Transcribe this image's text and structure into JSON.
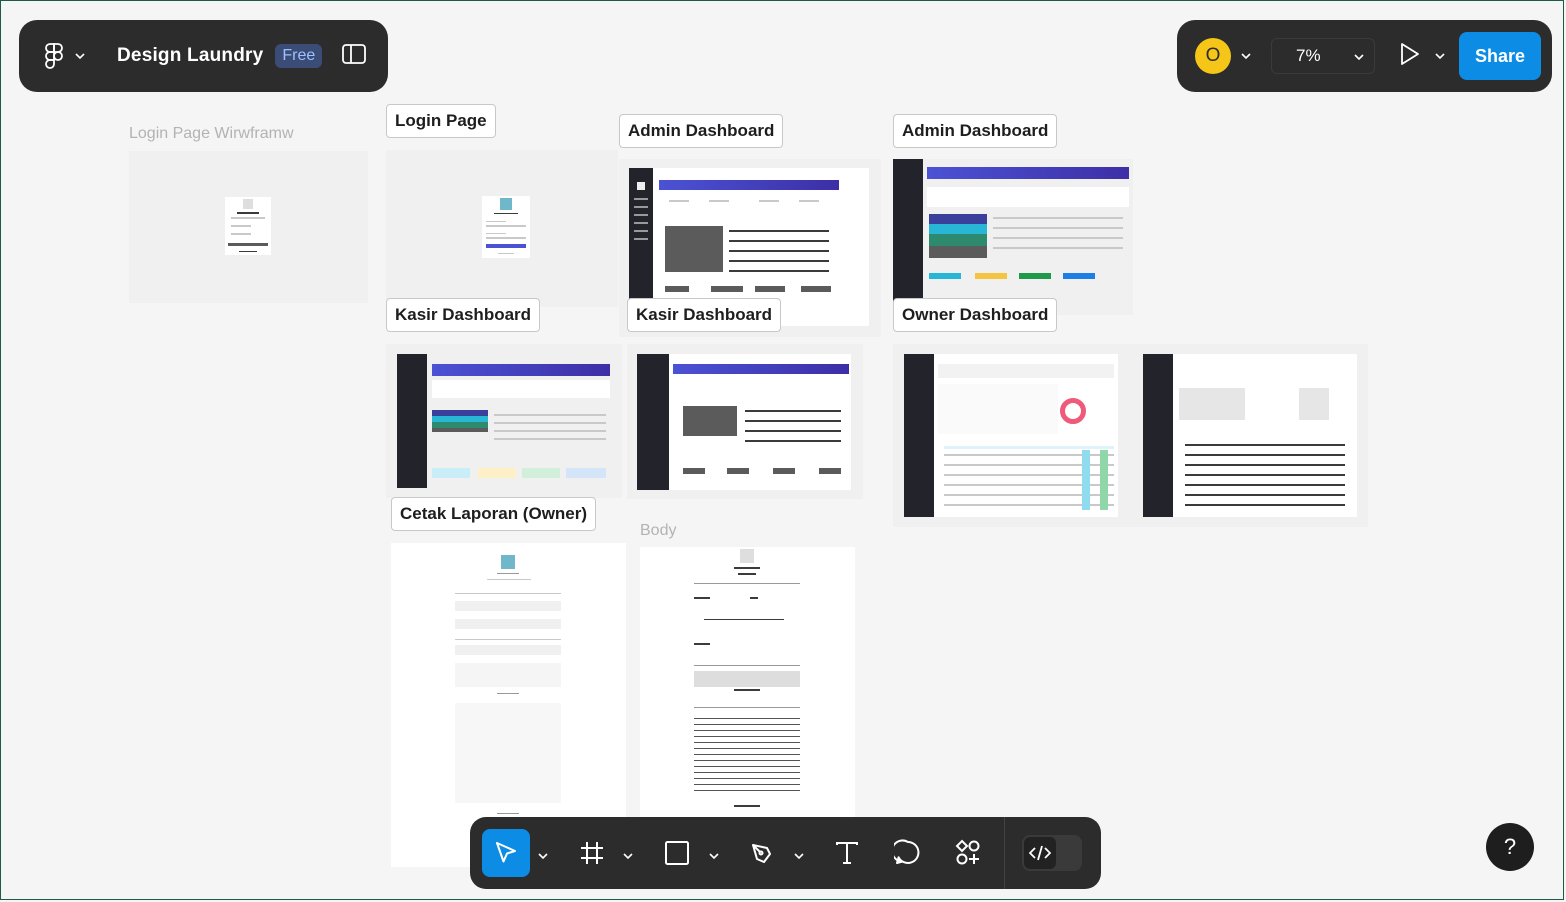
{
  "file": {
    "title": "Design Laundry",
    "plan_badge": "Free"
  },
  "user": {
    "initial": "O",
    "color": "#f5c518"
  },
  "zoom": {
    "value": "7%"
  },
  "share_label": "Share",
  "help_label": "?",
  "frames": {
    "login_wireframe": "Login Page Wirwframw",
    "login_page": "Login Page",
    "admin_dashboard_1": "Admin Dashboard",
    "admin_dashboard_2": "Admin Dashboard",
    "kasir_dashboard_1": "Kasir Dashboard",
    "kasir_dashboard_2": "Kasir Dashboard",
    "owner_dashboard": "Owner Dashboard",
    "cetak_laporan": "Cetak Laporan (Owner)",
    "body": "Body"
  },
  "tools": [
    "move-tool",
    "frame-tool",
    "rectangle-tool",
    "pen-tool",
    "text-tool",
    "comment-tool",
    "actions-tool",
    "dev-mode-toggle"
  ],
  "colors": {
    "toolbar_bg": "#2c2c2c",
    "accent": "#0d8ce6",
    "canvas": "#f5f5f5"
  }
}
